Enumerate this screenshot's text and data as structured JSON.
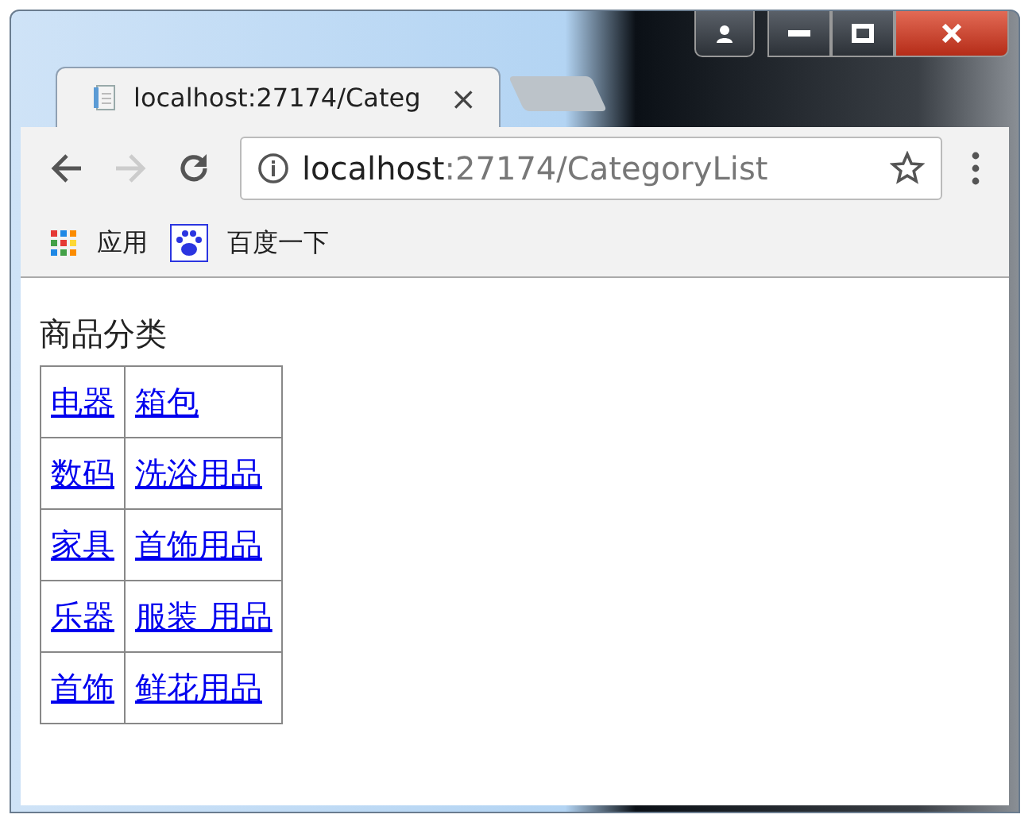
{
  "tab": {
    "title": "localhost:27174/Categ",
    "close": "×"
  },
  "address": {
    "host": "localhost",
    "path": ":27174/CategoryList"
  },
  "bookmarks": [
    {
      "kind": "apps",
      "label": "应用"
    },
    {
      "kind": "paw",
      "label": "百度一下"
    }
  ],
  "page": {
    "heading": "商品分类",
    "rows": [
      [
        "电器",
        "箱包"
      ],
      [
        "数码",
        "洗浴用品"
      ],
      [
        "家具",
        "首饰用品"
      ],
      [
        "乐器",
        "服装 用品"
      ],
      [
        "首饰",
        "鲜花用品"
      ]
    ]
  }
}
